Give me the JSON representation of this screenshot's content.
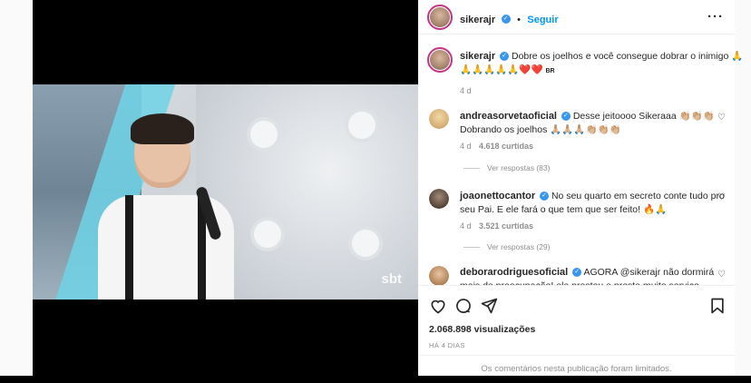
{
  "post": {
    "author": "sikerajr",
    "follow_label": "Seguir",
    "dot": "•",
    "caption_line1": "Dobre os joelhos e você consegue dobrar o inimigo 🙏",
    "caption_line2": "🙏🙏🙏🙏🙏❤️❤️",
    "caption_flag": "BR",
    "caption_age": "4 d",
    "views": "2.068.898 visualizações",
    "posted_ago": "HÁ 4 DIAS",
    "comments_limited": "Os comentários nesta publicação foram limitados."
  },
  "video": {
    "channel_logo": "sbt"
  },
  "comments": [
    {
      "user": "andreasorvetaoficial",
      "line1": "Desse jeitoooo Sikeraaa 👏🏼👏🏼👏🏼",
      "line2": "Dobrando os joelhos 🙏🏼🙏🏼🙏🏼👏🏼👏🏼👏🏼",
      "age": "4 d",
      "likes": "4.618 curtidas",
      "replies": "Ver respostas (83)"
    },
    {
      "user": "joaonettocantor",
      "line1": "No seu quarto em secreto conte tudo pro",
      "line2": "seu Pai. E ele fará o que tem que ser feito! 🔥🙏",
      "age": "4 d",
      "likes": "3.521 curtidas",
      "replies": "Ver respostas (29)"
    },
    {
      "user": "deborarodriguesoficial",
      "line1": "AGORA @sikerajr não dormirá",
      "line2": "mais de preocupação! ela prestou e presta muito serviço"
    }
  ],
  "icons": {
    "verified": "✓",
    "more": "···",
    "heart": "♡",
    "like": "heart-outline",
    "comment": "speech-bubble",
    "share": "paper-plane",
    "save": "bookmark"
  },
  "colors": {
    "accent": "#0095f6",
    "verified": "#3897f0",
    "text": "#262626",
    "muted": "#8e8e8e"
  }
}
